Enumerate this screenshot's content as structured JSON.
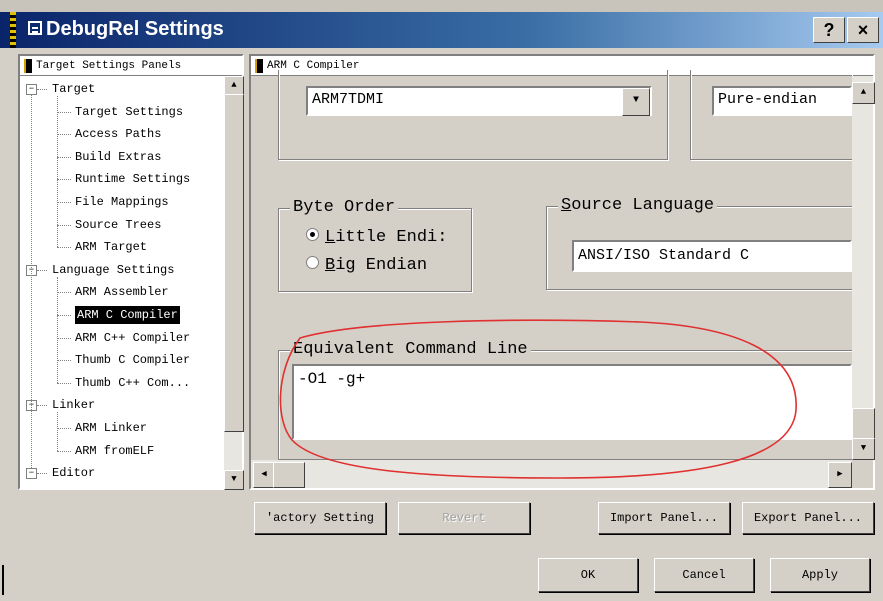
{
  "window": {
    "title": "DebugRel Settings",
    "help_label": "?",
    "close_label": "×"
  },
  "left_panel": {
    "header": "Target Settings Panels",
    "tree": [
      {
        "label": "Target",
        "level": 0,
        "expanded": true
      },
      {
        "label": "Target Settings",
        "level": 1
      },
      {
        "label": "Access Paths",
        "level": 1
      },
      {
        "label": "Build Extras",
        "level": 1
      },
      {
        "label": "Runtime Settings",
        "level": 1
      },
      {
        "label": "File Mappings",
        "level": 1
      },
      {
        "label": "Source Trees",
        "level": 1
      },
      {
        "label": "ARM Target",
        "level": 1
      },
      {
        "label": "Language Settings",
        "level": 0,
        "expanded": true
      },
      {
        "label": "ARM Assembler",
        "level": 1
      },
      {
        "label": "ARM C Compiler",
        "level": 1,
        "selected": true
      },
      {
        "label": "ARM C++ Compiler",
        "level": 1
      },
      {
        "label": "Thumb C Compiler",
        "level": 1
      },
      {
        "label": "Thumb C++ Com...",
        "level": 1
      },
      {
        "label": "Linker",
        "level": 0,
        "expanded": true
      },
      {
        "label": "ARM Linker",
        "level": 1
      },
      {
        "label": "ARM fromELF",
        "level": 1
      },
      {
        "label": "Editor",
        "level": 0,
        "expanded": true
      }
    ]
  },
  "right_panel": {
    "header": "ARM C Compiler",
    "processor_combo": "ARM7TDMI",
    "endian_combo": "Pure-endian",
    "byte_order": {
      "legend": "Byte Order",
      "options": [
        {
          "label": "Little Endi:",
          "accel": "L",
          "rest": "ittle Endi:",
          "checked": true
        },
        {
          "label": "Big Endian",
          "accel": "B",
          "rest": "ig Endian",
          "checked": false
        }
      ]
    },
    "source_language": {
      "legend_accel": "S",
      "legend_rest": "ource Language",
      "value": "ANSI/ISO Standard C"
    },
    "command_line": {
      "legend": "Equivalent Command Line",
      "value": "-O1 -g+"
    }
  },
  "buttons": {
    "factory": "'actory Setting",
    "revert": "Revert",
    "import": "Import Panel...",
    "export": "Export Panel...",
    "ok": "OK",
    "cancel": "Cancel",
    "apply": "Apply"
  },
  "colors": {
    "title_start": "#0a246a",
    "title_end": "#a6caf0",
    "face": "#d4d0c8",
    "annotation": "#e03030"
  }
}
